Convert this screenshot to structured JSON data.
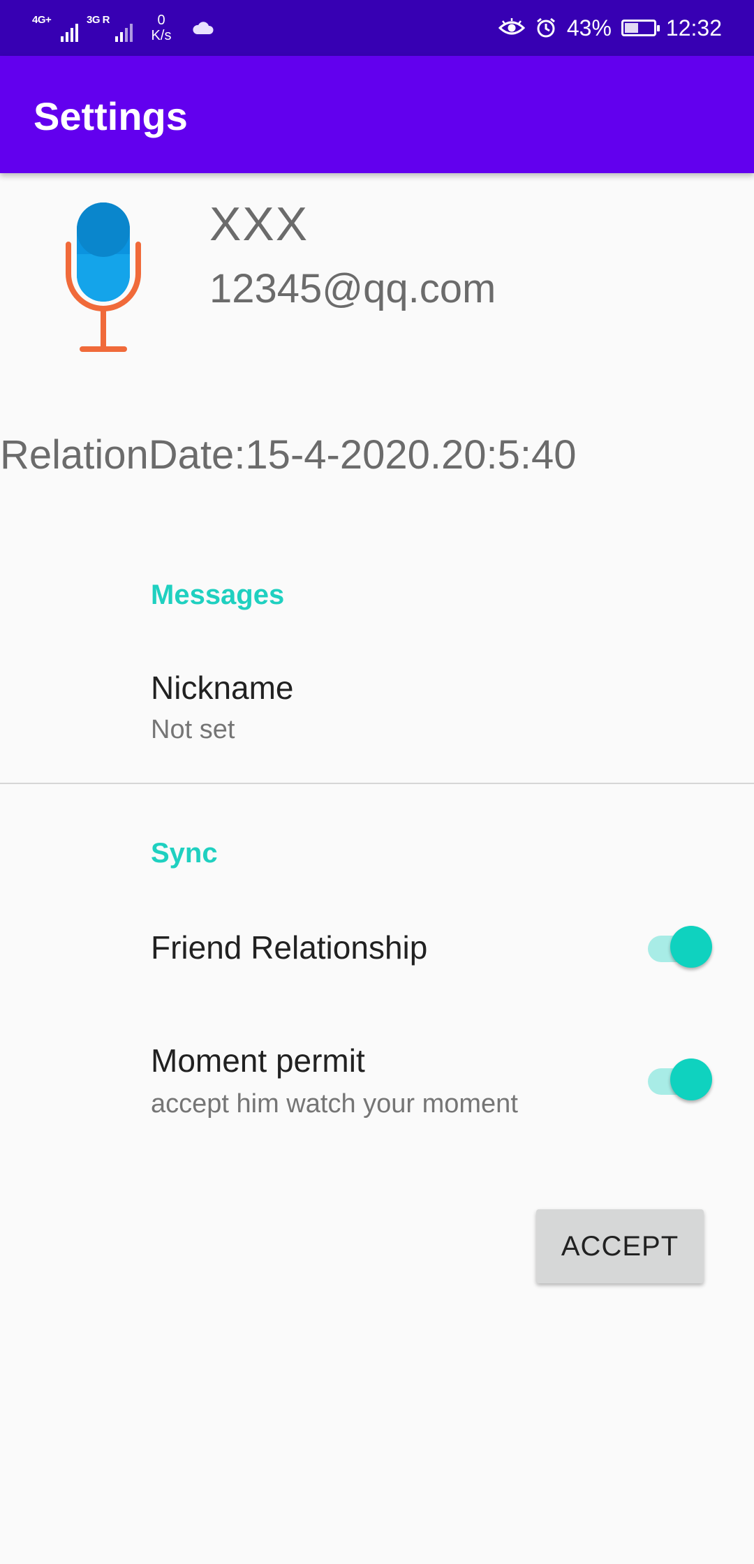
{
  "status_bar": {
    "signal1": "4G+",
    "signal2": "3G R",
    "speed_value": "0",
    "speed_unit": "K/s",
    "battery": "43%",
    "time": "12:32"
  },
  "app_bar": {
    "title": "Settings"
  },
  "profile": {
    "name": "XXX",
    "email": "12345@qq.com",
    "relation_date": "RelationDate:15-4-2020.20:5:40"
  },
  "messages_section": {
    "header": "Messages",
    "nickname_title": "Nickname",
    "nickname_summary": "Not set"
  },
  "sync_section": {
    "header": "Sync",
    "friend_relationship_title": "Friend Relationship",
    "friend_relationship_on": true,
    "moment_permit_title": "Moment permit",
    "moment_permit_summary": "accept him watch your moment",
    "moment_permit_on": true
  },
  "accept_button": "ACCEPT",
  "colors": {
    "status_bar": "#3700b3",
    "app_bar": "#6200ee",
    "accent": "#1fd0c0"
  }
}
